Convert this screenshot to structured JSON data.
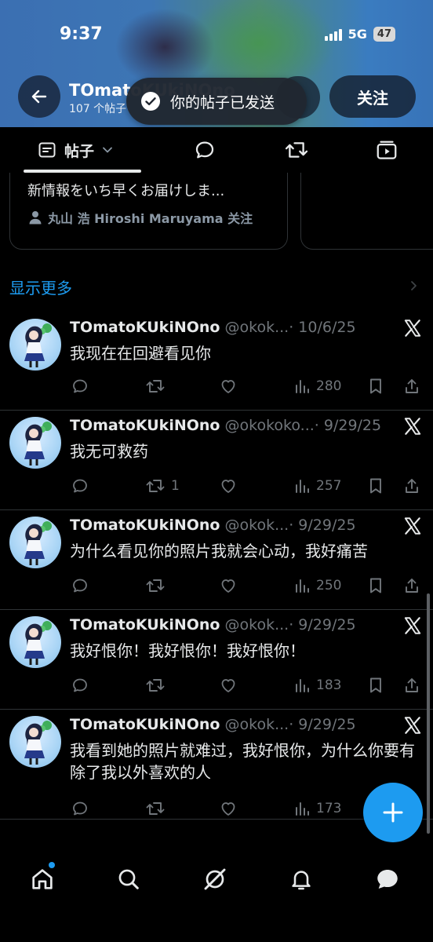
{
  "status_bar": {
    "time": "9:37",
    "network": "5G",
    "battery": "47"
  },
  "header": {
    "name": "TOmatoKUkiNOno",
    "posts_count": "107 个帖子",
    "follow_label": "关注"
  },
  "toast": {
    "text": "你的帖子已发送"
  },
  "tabs": {
    "posts_label": "帖子"
  },
  "suggestion_card": {
    "text": "新情報をいち早くお届けしま...",
    "followed_by": "丸山 浩 Hiroshi Maruyama 关注"
  },
  "show_more": "显示更多",
  "posts": [
    {
      "name": "TOmatoKUkiNOno",
      "handle": "@okok...",
      "date": "· 10/6/25",
      "text": "我现在在回避看见你",
      "retweets": "",
      "views": "280"
    },
    {
      "name": "TOmatoKUkiNOno",
      "handle": "@okokoko...",
      "date": "· 9/29/25",
      "text": "我无可救药",
      "retweets": "1",
      "views": "257"
    },
    {
      "name": "TOmatoKUkiNOno",
      "handle": "@okok...",
      "date": "· 9/29/25",
      "text": "为什么看见你的照片我就会心动，我好痛苦",
      "retweets": "",
      "views": "250"
    },
    {
      "name": "TOmatoKUkiNOno",
      "handle": "@okok...",
      "date": "· 9/29/25",
      "text": "我好恨你！我好恨你！我好恨你！",
      "retweets": "",
      "views": "183"
    },
    {
      "name": "TOmatoKUkiNOno",
      "handle": "@okok...",
      "date": "· 9/29/25",
      "text": "我看到她的照片就难过，我好恨你，为什么你要有除了我以外喜欢的人",
      "retweets": "",
      "views": "173"
    }
  ],
  "colors": {
    "accent": "#1d9bf0",
    "background": "#000000",
    "muted": "#71767b"
  },
  "icons": {
    "header": [
      "back-arrow-icon",
      "check-circle-icon"
    ],
    "tabs": [
      "posts-icon",
      "chevron-down-icon",
      "reply-icon",
      "retweet-icon",
      "video-icon"
    ],
    "post_actions": [
      "reply-icon",
      "retweet-icon",
      "like-icon",
      "views-icon",
      "bookmark-icon",
      "share-icon"
    ],
    "nav": [
      "home-icon",
      "search-icon",
      "grok-icon",
      "notifications-icon",
      "messages-icon"
    ]
  }
}
